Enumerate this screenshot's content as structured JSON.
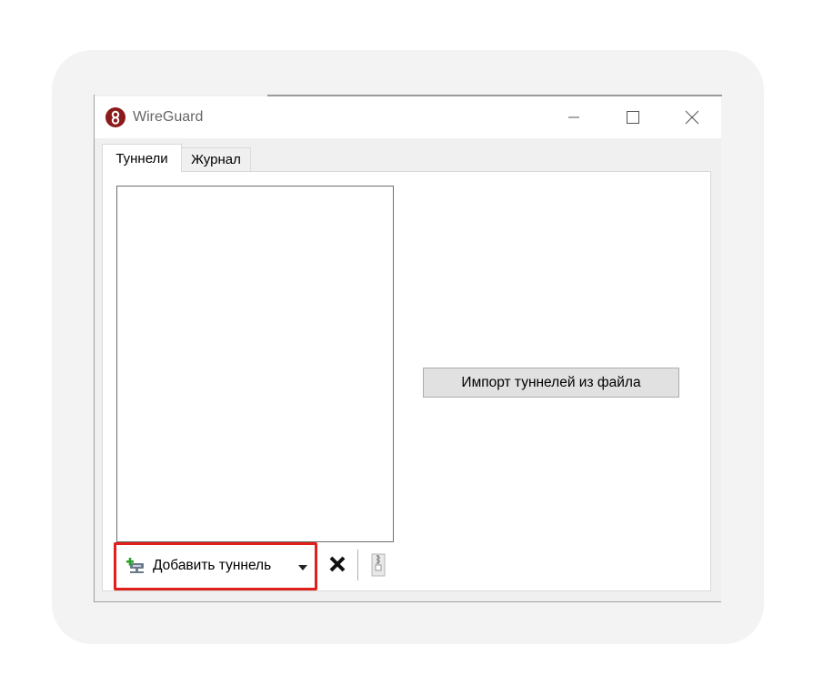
{
  "window": {
    "title": "WireGuard",
    "icon": "wireguard-logo-icon"
  },
  "title_controls": {
    "minimize_icon": "minimize-icon",
    "maximize_icon": "maximize-icon",
    "close_icon": "close-icon"
  },
  "tabs": [
    {
      "label": "Туннели",
      "active": true
    },
    {
      "label": "Журнал",
      "active": false
    }
  ],
  "import_button": {
    "label": "Импорт туннелей из файла"
  },
  "toolbar": {
    "add_label": "Добавить туннель",
    "add_icon": "add-tunnel-icon",
    "dropdown_icon": "chevron-down-icon",
    "delete_icon": "delete-x-icon",
    "export_icon": "zip-export-icon"
  },
  "colors": {
    "highlight_border": "#e0201a",
    "app_icon": "#8b1a1a"
  }
}
